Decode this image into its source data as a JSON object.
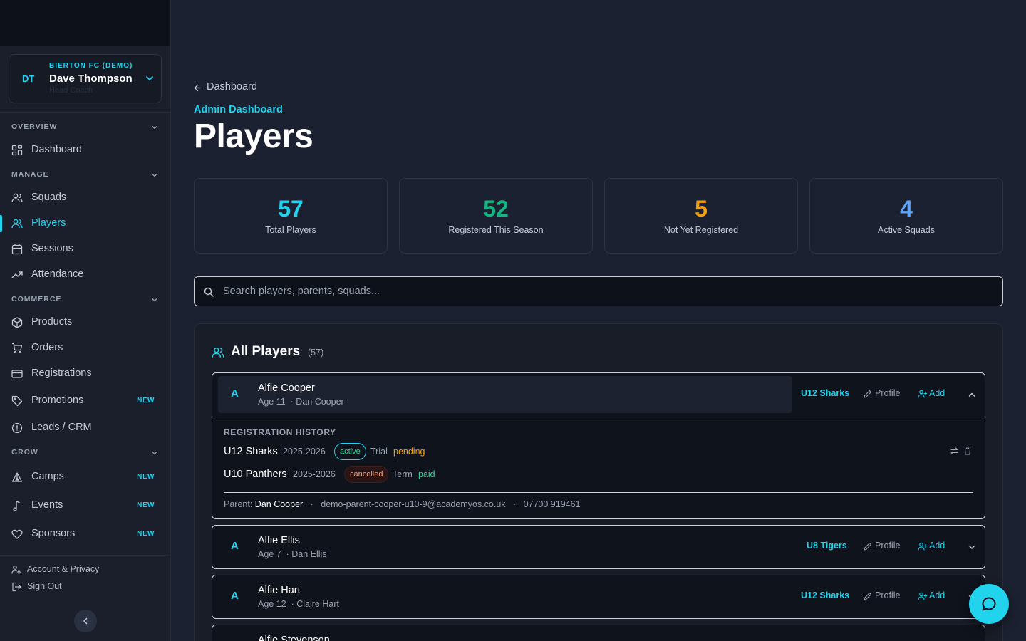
{
  "colors": {
    "accent": "#22d3ee",
    "stat_total": "#22d3ee",
    "stat_registered": "#10b981",
    "stat_not_registered": "#f59e0b",
    "stat_squads": "#60a5fa",
    "pending": "#f59e0b",
    "paid": "#34d399"
  },
  "user": {
    "initials": "DT",
    "org": "BIERTON FC (DEMO)",
    "name": "Dave Thompson",
    "role": "Head Coach"
  },
  "sidebar": {
    "sections": [
      {
        "label": "OVERVIEW",
        "items": [
          {
            "label": "Dashboard",
            "icon": "grid-icon"
          }
        ]
      },
      {
        "label": "MANAGE",
        "items": [
          {
            "label": "Squads",
            "icon": "users-icon"
          },
          {
            "label": "Players",
            "icon": "users-icon",
            "active": true
          },
          {
            "label": "Sessions",
            "icon": "calendar-icon"
          },
          {
            "label": "Attendance",
            "icon": "trend-up-icon"
          }
        ]
      },
      {
        "label": "COMMERCE",
        "items": [
          {
            "label": "Products",
            "icon": "package-icon"
          },
          {
            "label": "Orders",
            "icon": "cart-icon"
          },
          {
            "label": "Registrations",
            "icon": "card-icon"
          },
          {
            "label": "Promotions",
            "icon": "tag-icon",
            "badge": "NEW"
          },
          {
            "label": "Leads / CRM",
            "icon": "alert-circle-icon"
          }
        ]
      },
      {
        "label": "GROW",
        "items": [
          {
            "label": "Camps",
            "icon": "tent-icon",
            "badge": "NEW"
          },
          {
            "label": "Events",
            "icon": "music-icon",
            "badge": "NEW"
          },
          {
            "label": "Sponsors",
            "icon": "heart-icon",
            "badge": "NEW"
          }
        ]
      }
    ],
    "footer": {
      "account": "Account & Privacy",
      "signout": "Sign Out"
    }
  },
  "main": {
    "back_label": "Dashboard",
    "breadcrumb": "Admin Dashboard",
    "title": "Players",
    "stats": [
      {
        "value": "57",
        "label": "Total Players"
      },
      {
        "value": "52",
        "label": "Registered This Season"
      },
      {
        "value": "5",
        "label": "Not Yet Registered"
      },
      {
        "value": "4",
        "label": "Active Squads"
      }
    ],
    "search_placeholder": "Search players, parents, squads...",
    "panel_title": "All Players",
    "panel_count": "(57)",
    "actions": {
      "profile": "Profile",
      "add": "Add"
    },
    "players": [
      {
        "initial": "A",
        "name": "Alfie Cooper",
        "age": "Age 11",
        "parent": "· Dan Cooper",
        "squad": "U12 Sharks",
        "expanded": true,
        "history_title": "REGISTRATION HISTORY",
        "history": [
          {
            "squad": "U12 Sharks",
            "season": "2025-2026",
            "status": "active",
            "type": "Trial",
            "payment": "pending"
          },
          {
            "squad": "U10 Panthers",
            "season": "2025-2026",
            "status": "cancelled",
            "type": "Term",
            "payment": "paid"
          }
        ],
        "parent_label": "Parent:",
        "parent_name": "Dan Cooper",
        "parent_email": "demo-parent-cooper-u10-9@academyos.co.uk",
        "parent_phone": "07700 919461"
      },
      {
        "initial": "A",
        "name": "Alfie Ellis",
        "age": "Age 7",
        "parent": "· Dan Ellis",
        "squad": "U8 Tigers"
      },
      {
        "initial": "A",
        "name": "Alfie Hart",
        "age": "Age 12",
        "parent": "· Claire Hart",
        "squad": "U12 Sharks"
      },
      {
        "initial": "A",
        "name": "Alfie Stevenson"
      }
    ]
  }
}
